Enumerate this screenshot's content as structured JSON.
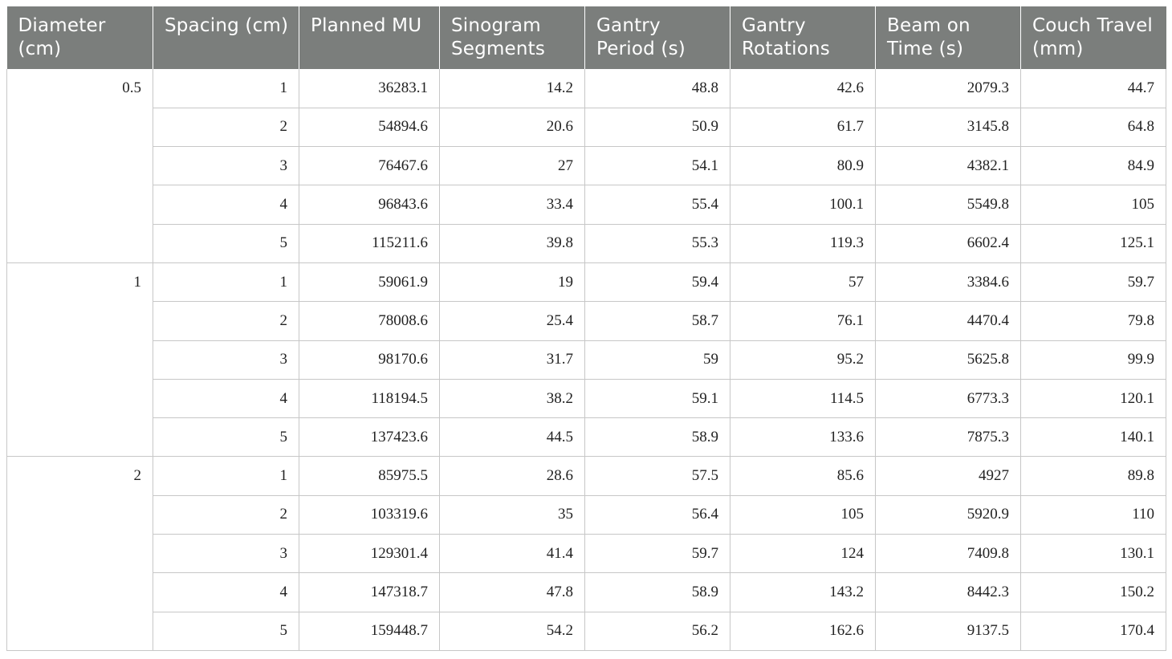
{
  "table": {
    "headers": [
      "Diameter (cm)",
      "Spacing (cm)",
      "Planned MU",
      "Sinogram Segments",
      "Gantry Period (s)",
      "Gantry Rotations",
      "Beam on Time (s)",
      "Couch Travel (mm)"
    ],
    "groups": [
      {
        "diameter": "0.5",
        "rows": [
          [
            "1",
            "36283.1",
            "14.2",
            "48.8",
            "42.6",
            "2079.3",
            "44.7"
          ],
          [
            "2",
            "54894.6",
            "20.6",
            "50.9",
            "61.7",
            "3145.8",
            "64.8"
          ],
          [
            "3",
            "76467.6",
            "27",
            "54.1",
            "80.9",
            "4382.1",
            "84.9"
          ],
          [
            "4",
            "96843.6",
            "33.4",
            "55.4",
            "100.1",
            "5549.8",
            "105"
          ],
          [
            "5",
            "115211.6",
            "39.8",
            "55.3",
            "119.3",
            "6602.4",
            "125.1"
          ]
        ]
      },
      {
        "diameter": "1",
        "rows": [
          [
            "1",
            "59061.9",
            "19",
            "59.4",
            "57",
            "3384.6",
            "59.7"
          ],
          [
            "2",
            "78008.6",
            "25.4",
            "58.7",
            "76.1",
            "4470.4",
            "79.8"
          ],
          [
            "3",
            "98170.6",
            "31.7",
            "59",
            "95.2",
            "5625.8",
            "99.9"
          ],
          [
            "4",
            "118194.5",
            "38.2",
            "59.1",
            "114.5",
            "6773.3",
            "120.1"
          ],
          [
            "5",
            "137423.6",
            "44.5",
            "58.9",
            "133.6",
            "7875.3",
            "140.1"
          ]
        ]
      },
      {
        "diameter": "2",
        "rows": [
          [
            "1",
            "85975.5",
            "28.6",
            "57.5",
            "85.6",
            "4927",
            "89.8"
          ],
          [
            "2",
            "103319.6",
            "35",
            "56.4",
            "105",
            "5920.9",
            "110"
          ],
          [
            "3",
            "129301.4",
            "41.4",
            "59.7",
            "124",
            "7409.8",
            "130.1"
          ],
          [
            "4",
            "147318.7",
            "47.8",
            "58.9",
            "143.2",
            "8442.3",
            "150.2"
          ],
          [
            "5",
            "159448.7",
            "54.2",
            "56.2",
            "162.6",
            "9137.5",
            "170.4"
          ]
        ]
      }
    ]
  }
}
